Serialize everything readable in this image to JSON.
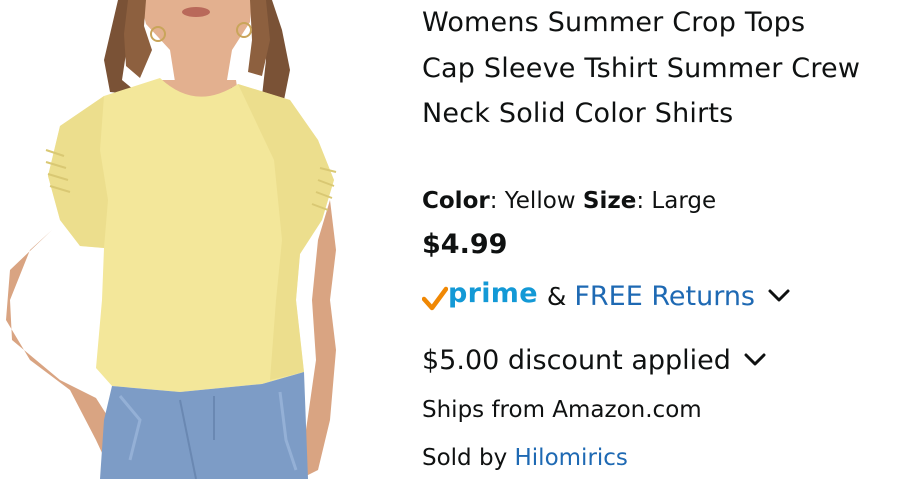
{
  "product": {
    "title": "Womens Summer Crop Tops Cap Sleeve Tshirt Summer Crew Neck Solid Color Shirts",
    "image_alt": "Woman wearing a yellow cap-sleeve crew neck crop t-shirt with light blue jeans"
  },
  "variation": {
    "color_label": "Color",
    "color_value": "Yellow",
    "size_label": "Size",
    "size_value": "Large"
  },
  "price": "$4.99",
  "delivery": {
    "prime_label": "prime",
    "ampersand": "&",
    "free_returns": "FREE Returns"
  },
  "discount": {
    "text": "$5.00 discount applied"
  },
  "fulfillment": {
    "ships_from": "Ships from Amazon.com",
    "sold_by_prefix": "Sold by",
    "seller": "Hilomirics"
  },
  "colors": {
    "prime_blue": "#1399d6",
    "prime_check": "#f08804",
    "link_blue": "#1e69b3",
    "text": "#0f1111",
    "shirt_yellow": "#f3e79a"
  },
  "icons": {
    "prime_check": "prime-checkmark-icon",
    "expand": "chevron-down-icon"
  }
}
